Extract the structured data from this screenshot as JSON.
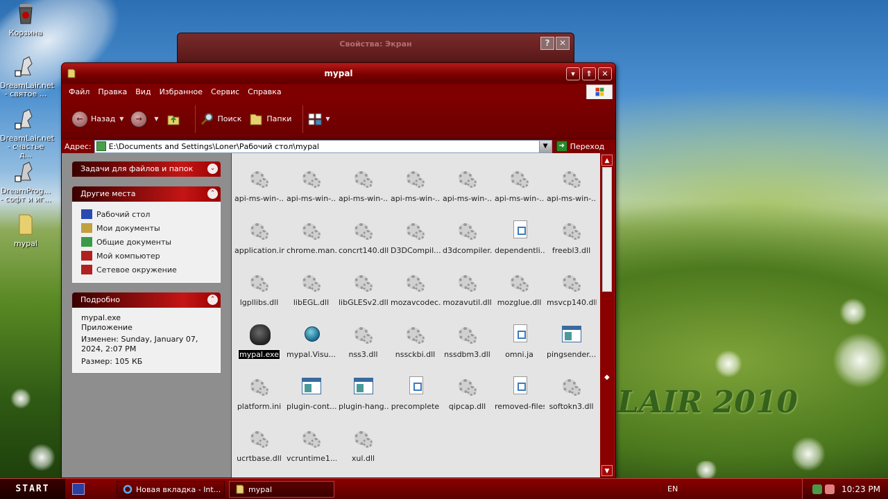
{
  "desktop": {
    "icons": [
      {
        "label": "Корзина",
        "icon": "recycle-bin-icon"
      },
      {
        "label": "DreamLair.net - святое ...",
        "icon": "dreamlair-shortcut-icon"
      },
      {
        "label": "DreamLair.net - счастье д...",
        "icon": "dreamlair-shortcut-icon"
      },
      {
        "label": "DreamProg... - софт и иг...",
        "icon": "dreamprog-shortcut-icon"
      },
      {
        "label": "mypal",
        "icon": "folder-icon"
      }
    ],
    "wallpaper_text": "LAIR 2010"
  },
  "bg_dialog": {
    "title": "Свойства: Экран",
    "help": "?",
    "close": "✕"
  },
  "window": {
    "title": "mypal",
    "menu": [
      "Файл",
      "Правка",
      "Вид",
      "Избранное",
      "Сервис",
      "Справка"
    ],
    "toolbar": {
      "back": "Назад",
      "search": "Поиск",
      "folders": "Папки"
    },
    "address": {
      "label": "Адрес:",
      "value": "E:\\Documents and Settings\\Loner\\Рабочий стол\\mypal",
      "go": "Переход"
    },
    "left": {
      "tasks_title": "Задачи для файлов и папок",
      "places_title": "Другие места",
      "places": [
        {
          "label": "Рабочий стол",
          "color": "#2a4ab0"
        },
        {
          "label": "Мои документы",
          "color": "#c0a040"
        },
        {
          "label": "Общие документы",
          "color": "#3a9a4a"
        },
        {
          "label": "Мой компьютер",
          "color": "#b02020"
        },
        {
          "label": "Сетевое окружение",
          "color": "#b02020"
        }
      ],
      "details_title": "Подробно",
      "details": {
        "name": "mypal.exe",
        "type": "Приложение",
        "modified": "Изменен: Sunday, January 07, 2024, 2:07 PM",
        "size": "Размер: 105 КБ"
      }
    },
    "files": [
      {
        "label": "api-ms-win-...",
        "kind": "gear"
      },
      {
        "label": "api-ms-win-...",
        "kind": "gear"
      },
      {
        "label": "api-ms-win-...",
        "kind": "gear"
      },
      {
        "label": "api-ms-win-...",
        "kind": "gear"
      },
      {
        "label": "api-ms-win-...",
        "kind": "gear"
      },
      {
        "label": "api-ms-win-...",
        "kind": "gear"
      },
      {
        "label": "api-ms-win-...",
        "kind": "gear"
      },
      {
        "label": "application.ini",
        "kind": "gear"
      },
      {
        "label": "chrome.man...",
        "kind": "gear"
      },
      {
        "label": "concrt140.dll",
        "kind": "gear"
      },
      {
        "label": "D3DCompil...",
        "kind": "gear"
      },
      {
        "label": "d3dcompiler...",
        "kind": "gear"
      },
      {
        "label": "dependentli...",
        "kind": "doc"
      },
      {
        "label": "freebl3.dll",
        "kind": "gear"
      },
      {
        "label": "lgpllibs.dll",
        "kind": "gear"
      },
      {
        "label": "libEGL.dll",
        "kind": "gear"
      },
      {
        "label": "libGLESv2.dll",
        "kind": "gear"
      },
      {
        "label": "mozavcodec...",
        "kind": "gear"
      },
      {
        "label": "mozavutil.dll",
        "kind": "gear"
      },
      {
        "label": "mozglue.dll",
        "kind": "gear"
      },
      {
        "label": "msvcp140.dll",
        "kind": "gear"
      },
      {
        "label": "mypal.exe",
        "kind": "wolf",
        "selected": true
      },
      {
        "label": "mypal.Visu...",
        "kind": "globe"
      },
      {
        "label": "nss3.dll",
        "kind": "gear"
      },
      {
        "label": "nssckbi.dll",
        "kind": "gear"
      },
      {
        "label": "nssdbm3.dll",
        "kind": "gear"
      },
      {
        "label": "omni.ja",
        "kind": "doc"
      },
      {
        "label": "pingsender....",
        "kind": "win"
      },
      {
        "label": "platform.ini",
        "kind": "gear"
      },
      {
        "label": "plugin-cont...",
        "kind": "win"
      },
      {
        "label": "plugin-hang...",
        "kind": "win"
      },
      {
        "label": "precomplete",
        "kind": "doc"
      },
      {
        "label": "qipcap.dll",
        "kind": "gear"
      },
      {
        "label": "removed-files",
        "kind": "doc"
      },
      {
        "label": "softokn3.dll",
        "kind": "gear"
      },
      {
        "label": "ucrtbase.dll",
        "kind": "gear"
      },
      {
        "label": "vcruntime1...",
        "kind": "gear"
      },
      {
        "label": "xul.dll",
        "kind": "gear"
      }
    ]
  },
  "taskbar": {
    "start": "START",
    "tasks": [
      {
        "label": "Новая вкладка - Int...",
        "icon": "ie-icon",
        "active": false
      },
      {
        "label": "mypal",
        "icon": "folder-icon",
        "active": true
      }
    ],
    "lang": "EN",
    "clock": "10:23 PM"
  },
  "colors": {
    "accent": "#8a0b0b",
    "title": "#b51a1a"
  }
}
